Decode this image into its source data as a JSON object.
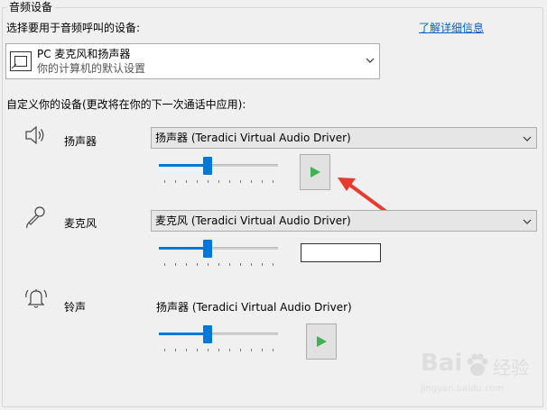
{
  "group": {
    "title": "音频设备"
  },
  "header": {
    "select_label": "选择要用于音频呼叫的设备:",
    "learn_more": "了解详细信息"
  },
  "device": {
    "name": "PC 麦克风和扬声器",
    "subtitle": "你的计算机的默认设置"
  },
  "custom_label": "自定义你的设备(更改将在你的下一次通话中应用):",
  "speaker": {
    "label": "扬声器",
    "selected": "扬声器 (Teradici Virtual Audio Driver)",
    "volume": 0.4
  },
  "microphone": {
    "label": "麦克风",
    "selected": "麦克风 (Teradici Virtual Audio Driver)",
    "volume": 0.4
  },
  "ringer": {
    "label": "铃声",
    "selected": "扬声器 (Teradici Virtual Audio Driver)",
    "volume": 0.4
  },
  "colors": {
    "accent": "#0078d7",
    "play_green": "#3fb34f",
    "arrow_red": "#e83a2e",
    "link": "#0b5ec6"
  },
  "watermark": {
    "brand": "Bai",
    "brand_suffix": "经验",
    "url": "jingyan.baidu.com"
  }
}
